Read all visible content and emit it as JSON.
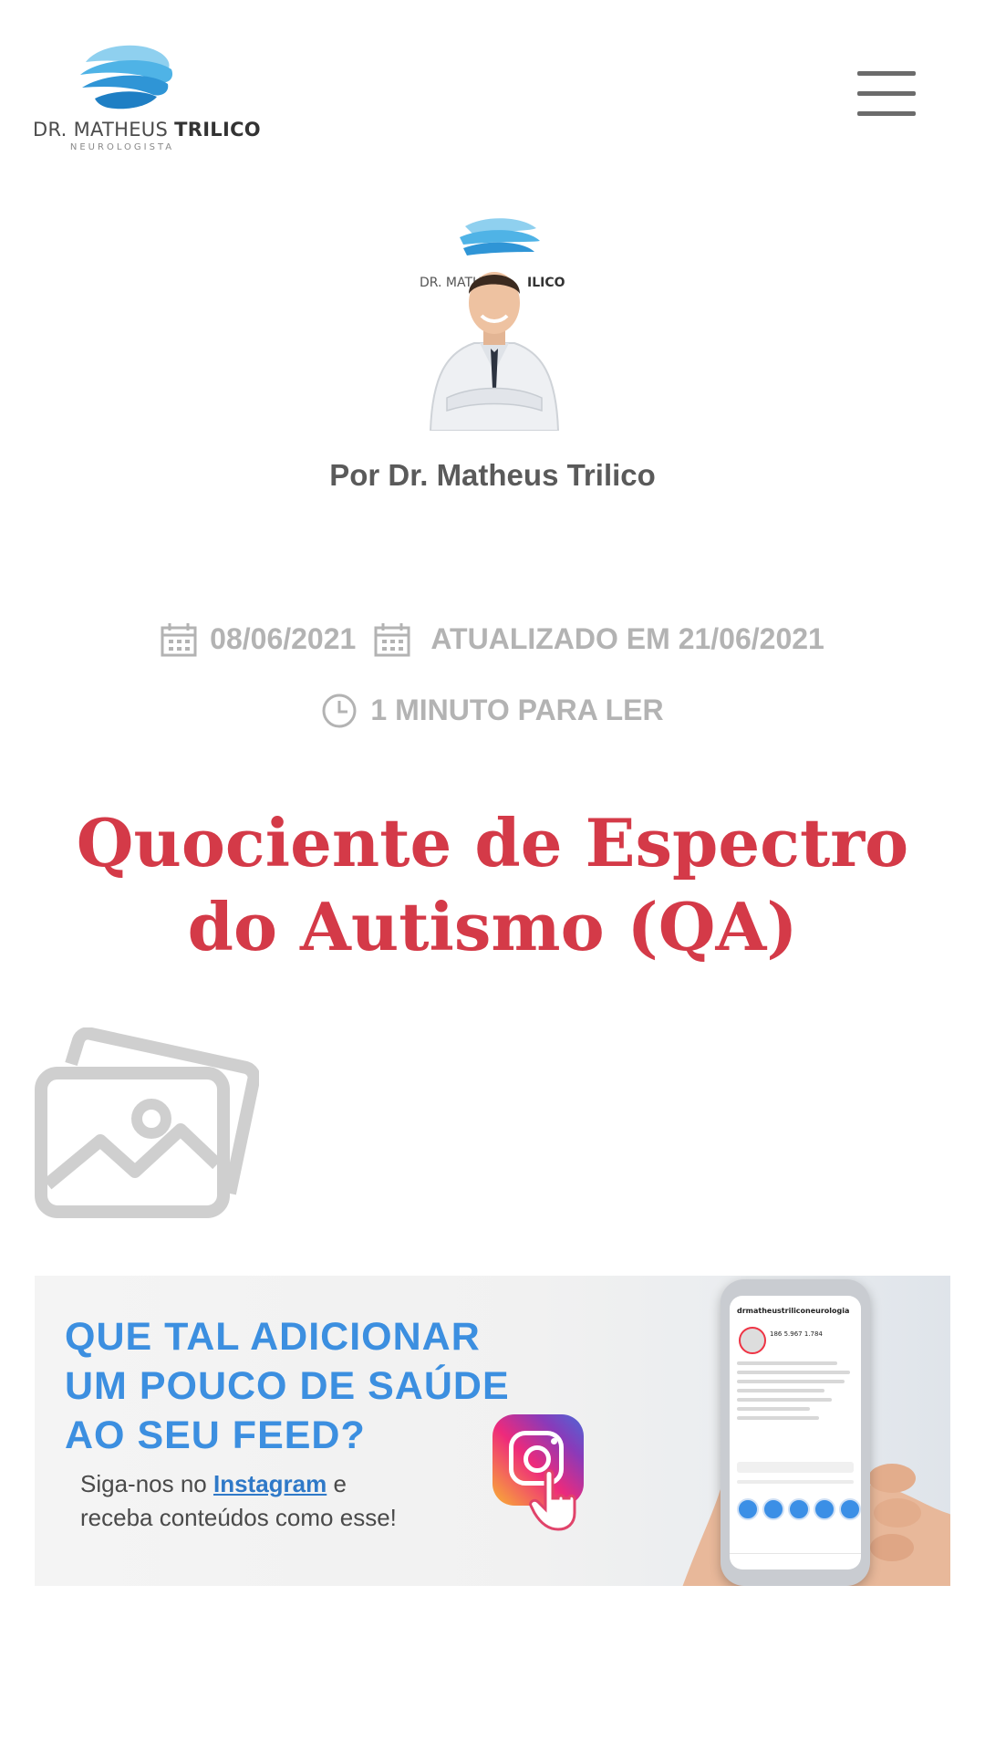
{
  "header": {
    "logo_name_regular": "DR. MATHEUS ",
    "logo_name_bold": "TRILICO",
    "logo_subtitle": "NEUROLOGISTA",
    "menu_icon": "hamburger-icon"
  },
  "author": {
    "byline": "Por Dr. Matheus Trilico",
    "photo_logo_text": "DR. MATHEUS TRILICO"
  },
  "meta": {
    "published": "08/06/2021",
    "updated": "ATUALIZADO EM 21/06/2021",
    "reading_time": "1 MINUTO PARA LER",
    "icons": [
      "calendar-icon",
      "calendar-icon",
      "clock-icon"
    ]
  },
  "post": {
    "title": "Quociente de Espectro do Autismo (QA)",
    "image_icon": "image-placeholder-icon"
  },
  "banner": {
    "headline_1": "QUE TAL ADICIONAR",
    "headline_2": "UM POUCO DE SAÚDE",
    "headline_3": "AO SEU FEED?",
    "sub_prefix": "Siga-nos no ",
    "sub_link": "Instagram",
    "sub_suffix": " e",
    "sub_line_2": "receba conteúdos como esse!",
    "phone_handle": "drmatheustriliconeurologia",
    "phone_stats": "186   5.967   1.784"
  },
  "colors": {
    "title": "#d43a48",
    "meta": "#b3b3b3",
    "banner_headline": "#3c8fe0",
    "logo_blue": "#3aa3dd"
  }
}
